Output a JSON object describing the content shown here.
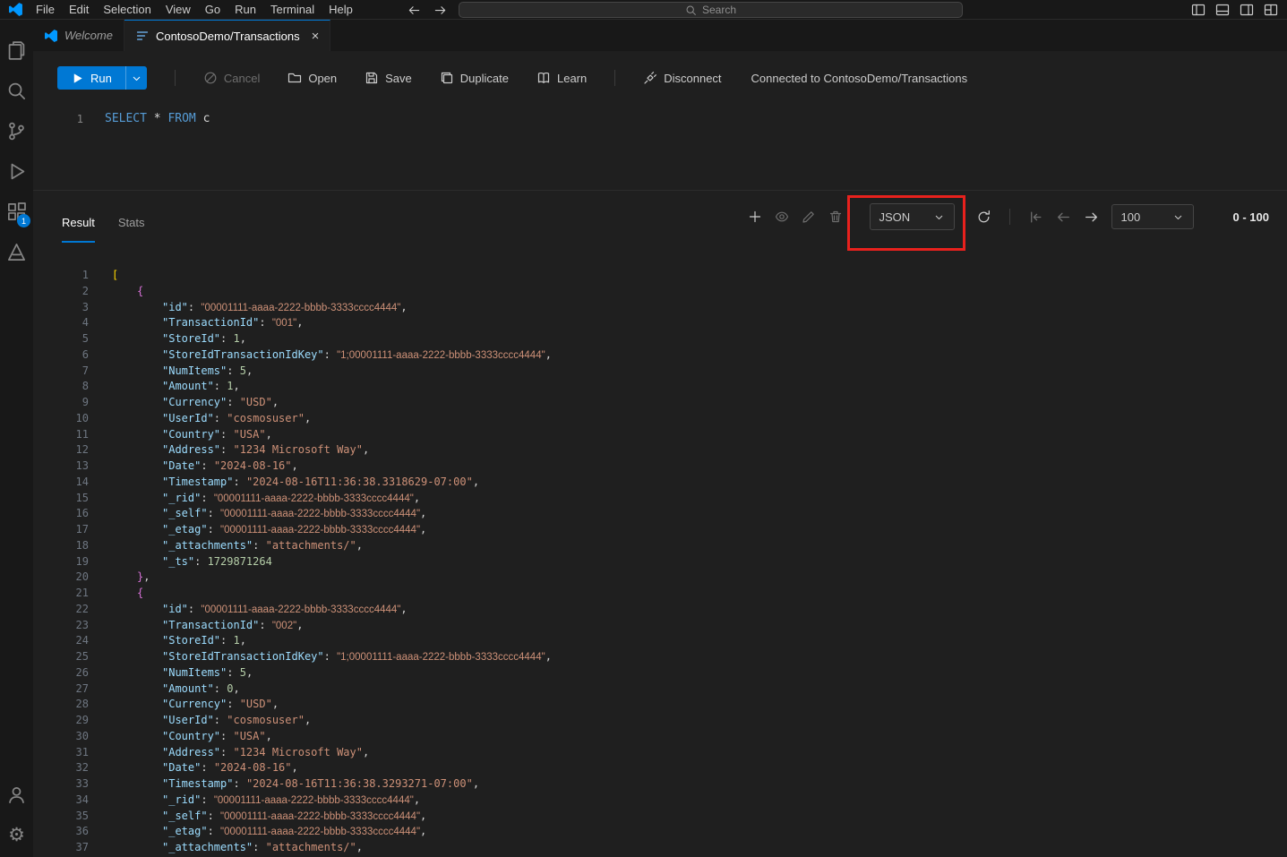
{
  "colors": {
    "accent": "#0078d4",
    "annotation": "#e8211d"
  },
  "title_bar": {
    "menus": [
      "File",
      "Edit",
      "Selection",
      "View",
      "Go",
      "Run",
      "Terminal",
      "Help"
    ],
    "search_placeholder": "Search",
    "window_icons": [
      "layout-sidebar-left",
      "layout-panel",
      "layout-sidebar-right",
      "layout-grid"
    ]
  },
  "activity_bar": {
    "items": [
      {
        "name": "explorer",
        "icon": "files"
      },
      {
        "name": "search",
        "icon": "search"
      },
      {
        "name": "source-control",
        "icon": "source-control"
      },
      {
        "name": "run-and-debug",
        "icon": "debug"
      },
      {
        "name": "extensions",
        "icon": "extensions",
        "badge": "1"
      },
      {
        "name": "azure",
        "icon": "azure"
      }
    ],
    "bottom_items": [
      {
        "name": "accounts",
        "icon": "account"
      },
      {
        "name": "settings",
        "icon": "gear"
      }
    ]
  },
  "editor_tabs": [
    {
      "label": "Welcome",
      "icon": "vscode-logo",
      "active": false,
      "preview": true,
      "closable": false
    },
    {
      "label": "ContosoDemo/Transactions",
      "icon": "query-file",
      "active": true,
      "preview": false,
      "closable": true
    }
  ],
  "query_toolbar": {
    "run_label": "Run",
    "buttons": [
      {
        "name": "cancel",
        "icon": "circle-slash",
        "label": "Cancel",
        "disabled": true,
        "sep_before": true
      },
      {
        "name": "open",
        "icon": "folder",
        "label": "Open",
        "disabled": false,
        "sep_before": false
      },
      {
        "name": "save",
        "icon": "save",
        "label": "Save",
        "disabled": false,
        "sep_before": false
      },
      {
        "name": "duplicate",
        "icon": "copy",
        "label": "Duplicate",
        "disabled": false,
        "sep_before": false
      },
      {
        "name": "learn",
        "icon": "book",
        "label": "Learn",
        "disabled": false,
        "sep_before": false
      },
      {
        "name": "disconnect",
        "icon": "plug",
        "label": "Disconnect",
        "disabled": false,
        "sep_before": true
      }
    ],
    "connection_status": "Connected to ContosoDemo/Transactions"
  },
  "query_editor": {
    "line_number": "1",
    "tokens": [
      [
        "kw",
        "SELECT"
      ],
      [
        "pl",
        " * "
      ],
      [
        "kw",
        "FROM"
      ],
      [
        "pl",
        " c"
      ]
    ]
  },
  "results": {
    "tabs": [
      {
        "label": "Result",
        "active": true
      },
      {
        "label": "Stats",
        "active": false
      }
    ],
    "format_dropdown": {
      "value": "JSON"
    },
    "page_size_dropdown": {
      "value": "100"
    },
    "range_label": "0 - 100",
    "lines": [
      {
        "i": 0,
        "t": [
          [
            "b1",
            "["
          ]
        ]
      },
      {
        "i": 1,
        "t": [
          [
            "b2",
            "{"
          ]
        ]
      },
      {
        "i": 2,
        "t": [
          [
            "k",
            "\"id\""
          ],
          [
            "p",
            ": "
          ],
          [
            "g",
            "\"00001111-aaaa-2222-bbbb-3333cccc4444\""
          ],
          [
            "p",
            ","
          ]
        ]
      },
      {
        "i": 2,
        "t": [
          [
            "k",
            "\"TransactionId\""
          ],
          [
            "p",
            ": "
          ],
          [
            "g",
            "\"001\""
          ],
          [
            "p",
            ","
          ]
        ]
      },
      {
        "i": 2,
        "t": [
          [
            "k",
            "\"StoreId\""
          ],
          [
            "p",
            ": "
          ],
          [
            "n",
            "1"
          ],
          [
            "p",
            ","
          ]
        ]
      },
      {
        "i": 2,
        "t": [
          [
            "k",
            "\"StoreIdTransactionIdKey\""
          ],
          [
            "p",
            ": "
          ],
          [
            "g",
            "\"1;00001111-aaaa-2222-bbbb-3333cccc4444\""
          ],
          [
            "p",
            ","
          ]
        ]
      },
      {
        "i": 2,
        "t": [
          [
            "k",
            "\"NumItems\""
          ],
          [
            "p",
            ": "
          ],
          [
            "n",
            "5"
          ],
          [
            "p",
            ","
          ]
        ]
      },
      {
        "i": 2,
        "t": [
          [
            "k",
            "\"Amount\""
          ],
          [
            "p",
            ": "
          ],
          [
            "n",
            "1"
          ],
          [
            "p",
            ","
          ]
        ]
      },
      {
        "i": 2,
        "t": [
          [
            "k",
            "\"Currency\""
          ],
          [
            "p",
            ": "
          ],
          [
            "s",
            "\"USD\""
          ],
          [
            "p",
            ","
          ]
        ]
      },
      {
        "i": 2,
        "t": [
          [
            "k",
            "\"UserId\""
          ],
          [
            "p",
            ": "
          ],
          [
            "s",
            "\"cosmosuser\""
          ],
          [
            "p",
            ","
          ]
        ]
      },
      {
        "i": 2,
        "t": [
          [
            "k",
            "\"Country\""
          ],
          [
            "p",
            ": "
          ],
          [
            "s",
            "\"USA\""
          ],
          [
            "p",
            ","
          ]
        ]
      },
      {
        "i": 2,
        "t": [
          [
            "k",
            "\"Address\""
          ],
          [
            "p",
            ": "
          ],
          [
            "s",
            "\"1234 Microsoft Way\""
          ],
          [
            "p",
            ","
          ]
        ]
      },
      {
        "i": 2,
        "t": [
          [
            "k",
            "\"Date\""
          ],
          [
            "p",
            ": "
          ],
          [
            "s",
            "\"2024-08-16\""
          ],
          [
            "p",
            ","
          ]
        ]
      },
      {
        "i": 2,
        "t": [
          [
            "k",
            "\"Timestamp\""
          ],
          [
            "p",
            ": "
          ],
          [
            "s",
            "\"2024-08-16T11:36:38.3318629-07:00\""
          ],
          [
            "p",
            ","
          ]
        ]
      },
      {
        "i": 2,
        "t": [
          [
            "k",
            "\"_rid\""
          ],
          [
            "p",
            ": "
          ],
          [
            "g",
            "\"00001111-aaaa-2222-bbbb-3333cccc4444\""
          ],
          [
            "p",
            ","
          ]
        ]
      },
      {
        "i": 2,
        "t": [
          [
            "k",
            "\"_self\""
          ],
          [
            "p",
            ": "
          ],
          [
            "g",
            "\"00001111-aaaa-2222-bbbb-3333cccc4444\""
          ],
          [
            "p",
            ","
          ]
        ]
      },
      {
        "i": 2,
        "t": [
          [
            "k",
            "\"_etag\""
          ],
          [
            "p",
            ": "
          ],
          [
            "g",
            "\"00001111-aaaa-2222-bbbb-3333cccc4444\""
          ],
          [
            "p",
            ","
          ]
        ]
      },
      {
        "i": 2,
        "t": [
          [
            "k",
            "\"_attachments\""
          ],
          [
            "p",
            ": "
          ],
          [
            "s",
            "\"attachments/\""
          ],
          [
            "p",
            ","
          ]
        ]
      },
      {
        "i": 2,
        "t": [
          [
            "k",
            "\"_ts\""
          ],
          [
            "p",
            ": "
          ],
          [
            "n",
            "1729871264"
          ]
        ]
      },
      {
        "i": 1,
        "t": [
          [
            "b2",
            "}"
          ],
          [
            "p",
            ","
          ]
        ]
      },
      {
        "i": 1,
        "t": [
          [
            "b2",
            "{"
          ]
        ]
      },
      {
        "i": 2,
        "t": [
          [
            "k",
            "\"id\""
          ],
          [
            "p",
            ": "
          ],
          [
            "g",
            "\"00001111-aaaa-2222-bbbb-3333cccc4444\""
          ],
          [
            "p",
            ","
          ]
        ]
      },
      {
        "i": 2,
        "t": [
          [
            "k",
            "\"TransactionId\""
          ],
          [
            "p",
            ": "
          ],
          [
            "g",
            "\"002\""
          ],
          [
            "p",
            ","
          ]
        ]
      },
      {
        "i": 2,
        "t": [
          [
            "k",
            "\"StoreId\""
          ],
          [
            "p",
            ": "
          ],
          [
            "n",
            "1"
          ],
          [
            "p",
            ","
          ]
        ]
      },
      {
        "i": 2,
        "t": [
          [
            "k",
            "\"StoreIdTransactionIdKey\""
          ],
          [
            "p",
            ": "
          ],
          [
            "g",
            "\"1;00001111-aaaa-2222-bbbb-3333cccc4444\""
          ],
          [
            "p",
            ","
          ]
        ]
      },
      {
        "i": 2,
        "t": [
          [
            "k",
            "\"NumItems\""
          ],
          [
            "p",
            ": "
          ],
          [
            "n",
            "5"
          ],
          [
            "p",
            ","
          ]
        ]
      },
      {
        "i": 2,
        "t": [
          [
            "k",
            "\"Amount\""
          ],
          [
            "p",
            ": "
          ],
          [
            "n",
            "0"
          ],
          [
            "p",
            ","
          ]
        ]
      },
      {
        "i": 2,
        "t": [
          [
            "k",
            "\"Currency\""
          ],
          [
            "p",
            ": "
          ],
          [
            "s",
            "\"USD\""
          ],
          [
            "p",
            ","
          ]
        ]
      },
      {
        "i": 2,
        "t": [
          [
            "k",
            "\"UserId\""
          ],
          [
            "p",
            ": "
          ],
          [
            "s",
            "\"cosmosuser\""
          ],
          [
            "p",
            ","
          ]
        ]
      },
      {
        "i": 2,
        "t": [
          [
            "k",
            "\"Country\""
          ],
          [
            "p",
            ": "
          ],
          [
            "s",
            "\"USA\""
          ],
          [
            "p",
            ","
          ]
        ]
      },
      {
        "i": 2,
        "t": [
          [
            "k",
            "\"Address\""
          ],
          [
            "p",
            ": "
          ],
          [
            "s",
            "\"1234 Microsoft Way\""
          ],
          [
            "p",
            ","
          ]
        ]
      },
      {
        "i": 2,
        "t": [
          [
            "k",
            "\"Date\""
          ],
          [
            "p",
            ": "
          ],
          [
            "s",
            "\"2024-08-16\""
          ],
          [
            "p",
            ","
          ]
        ]
      },
      {
        "i": 2,
        "t": [
          [
            "k",
            "\"Timestamp\""
          ],
          [
            "p",
            ": "
          ],
          [
            "s",
            "\"2024-08-16T11:36:38.3293271-07:00\""
          ],
          [
            "p",
            ","
          ]
        ]
      },
      {
        "i": 2,
        "t": [
          [
            "k",
            "\"_rid\""
          ],
          [
            "p",
            ": "
          ],
          [
            "g",
            "\"00001111-aaaa-2222-bbbb-3333cccc4444\""
          ],
          [
            "p",
            ","
          ]
        ]
      },
      {
        "i": 2,
        "t": [
          [
            "k",
            "\"_self\""
          ],
          [
            "p",
            ": "
          ],
          [
            "g",
            "\"00001111-aaaa-2222-bbbb-3333cccc4444\""
          ],
          [
            "p",
            ","
          ]
        ]
      },
      {
        "i": 2,
        "t": [
          [
            "k",
            "\"_etag\""
          ],
          [
            "p",
            ": "
          ],
          [
            "g",
            "\"00001111-aaaa-2222-bbbb-3333cccc4444\""
          ],
          [
            "p",
            ","
          ]
        ]
      },
      {
        "i": 2,
        "t": [
          [
            "k",
            "\"_attachments\""
          ],
          [
            "p",
            ": "
          ],
          [
            "s",
            "\"attachments/\""
          ],
          [
            "p",
            ","
          ]
        ]
      }
    ]
  }
}
